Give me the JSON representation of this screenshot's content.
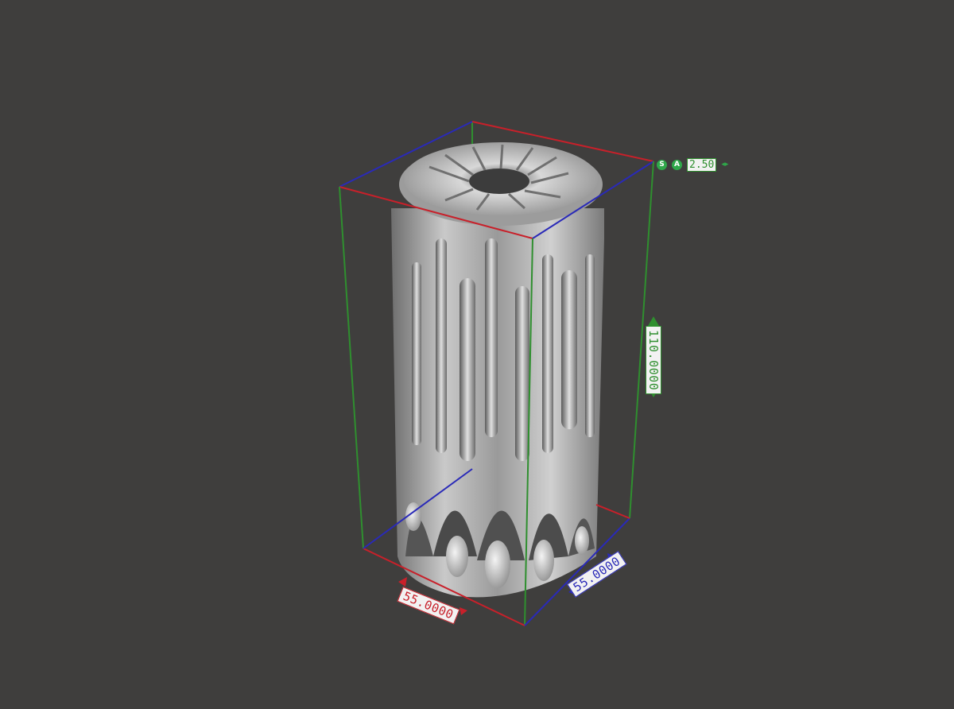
{
  "viewport": {
    "background": "#3f3e3d",
    "object": "fluted cylindrical part with flower-pattern top"
  },
  "dimensions": {
    "x_length": "55.0000",
    "y_length": "55.0000",
    "z_height": "110.0000",
    "axis_colors": {
      "x": "#c8202a",
      "y": "#2a2ab8",
      "z": "#2f8f2f"
    }
  },
  "gizmo": {
    "snap_icon": "S",
    "angle_icon": "A",
    "snap_value": "2.50",
    "stepper_icon": "◂▸"
  }
}
